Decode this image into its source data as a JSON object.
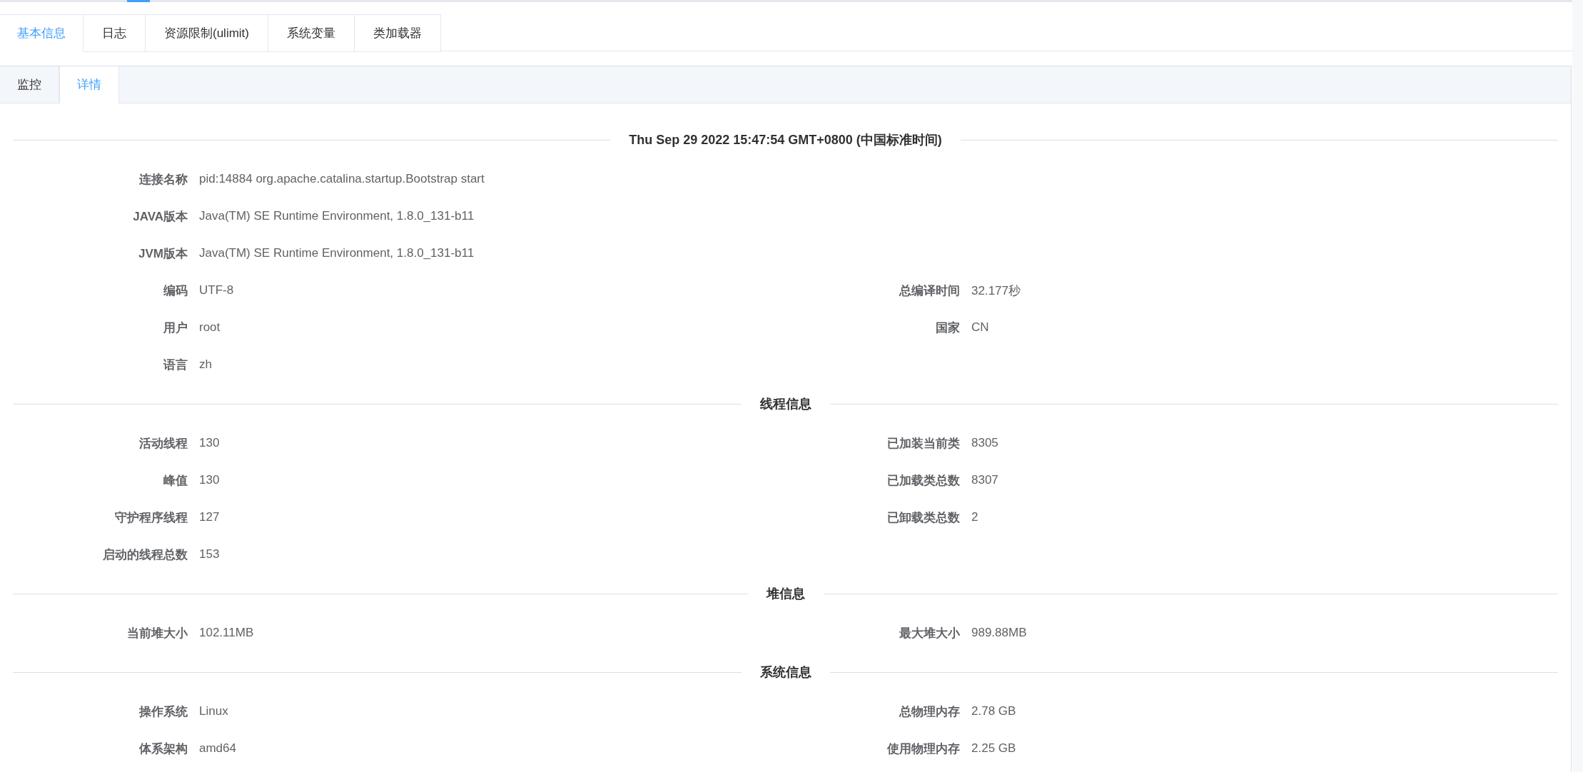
{
  "tabs": [
    {
      "label": "基本信息",
      "selected": true
    },
    {
      "label": "日志",
      "selected": false
    },
    {
      "label": "资源限制(ulimit)",
      "selected": false
    },
    {
      "label": "系统变量",
      "selected": false
    },
    {
      "label": "类加载器",
      "selected": false
    }
  ],
  "subtabs": [
    {
      "label": "监控",
      "selected": false
    },
    {
      "label": "详情",
      "selected": true
    }
  ],
  "sections": [
    {
      "title": "Thu Sep 29 2022 15:47:54 GMT+0800 (中国标准时间)",
      "rows": [
        {
          "left": {
            "label": "连接名称",
            "value": "pid:14884 org.apache.catalina.startup.Bootstrap start"
          }
        },
        {
          "left": {
            "label": "JAVA版本",
            "value": "Java(TM) SE Runtime Environment, 1.8.0_131-b11"
          }
        },
        {
          "left": {
            "label": "JVM版本",
            "value": "Java(TM) SE Runtime Environment, 1.8.0_131-b11"
          }
        },
        {
          "left": {
            "label": "编码",
            "value": "UTF-8"
          },
          "right": {
            "label": "总编译时间",
            "value": "32.177秒"
          }
        },
        {
          "left": {
            "label": "用户",
            "value": "root"
          },
          "right": {
            "label": "国家",
            "value": "CN"
          }
        },
        {
          "left": {
            "label": "语言",
            "value": "zh"
          }
        }
      ]
    },
    {
      "title": "线程信息",
      "rows": [
        {
          "left": {
            "label": "活动线程",
            "value": "130"
          },
          "right": {
            "label": "已加装当前类",
            "value": "8305"
          }
        },
        {
          "left": {
            "label": "峰值",
            "value": "130"
          },
          "right": {
            "label": "已加载类总数",
            "value": "8307"
          }
        },
        {
          "left": {
            "label": "守护程序线程",
            "value": "127"
          },
          "right": {
            "label": "已卸载类总数",
            "value": "2"
          }
        },
        {
          "left": {
            "label": "启动的线程总数",
            "value": "153"
          }
        }
      ]
    },
    {
      "title": "堆信息",
      "rows": [
        {
          "left": {
            "label": "当前堆大小",
            "value": "102.11MB"
          },
          "right": {
            "label": "最大堆大小",
            "value": "989.88MB"
          }
        }
      ]
    },
    {
      "title": "系统信息",
      "rows": [
        {
          "left": {
            "label": "操作系统",
            "value": "Linux"
          },
          "right": {
            "label": "总物理内存",
            "value": "2.78 GB"
          }
        },
        {
          "left": {
            "label": "体系架构",
            "value": "amd64"
          },
          "right": {
            "label": "使用物理内存",
            "value": "2.25 GB"
          }
        }
      ]
    }
  ]
}
